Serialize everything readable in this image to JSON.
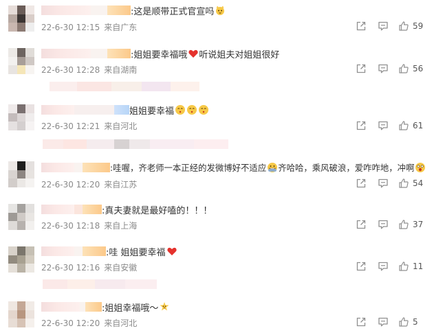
{
  "comments": [
    {
      "text": ":这是顺带正式官宣吗",
      "emoji": "cat-face",
      "date": "22-6-30 12:15",
      "location": "来自广东",
      "likes": "59",
      "reply_blur": false
    },
    {
      "text": ":姐姐要幸福哦",
      "emoji": "red-heart",
      "text2": " 听说姐夫对姐姐很好",
      "date": "22-6-30 12:28",
      "location": "来自湖南",
      "likes": "56",
      "reply_blur": true
    },
    {
      "text": "姐姐要幸福",
      "emoji": "kiss-face-x3",
      "date": "22-6-30 12:21",
      "location": "来自河北",
      "likes": "61",
      "reply_blur": true
    },
    {
      "text": ":哇喔，齐老师一本正经的发微博好不适应",
      "emoji": "grin-face",
      "text2": "齐哈哈，乘风破浪，爱咋咋地，冲啊",
      "date": "22-6-30 12:20",
      "location": "来自江苏",
      "likes": "54",
      "reply_blur": false
    },
    {
      "text": ":真夫妻就是最好嗑的！！！",
      "date": "22-6-30 12:18",
      "location": "来自上海",
      "likes": "37",
      "reply_blur": false
    },
    {
      "text": ":哇 姐姐要幸福",
      "emoji": "red-heart",
      "date": "22-6-30 12:16",
      "location": "来自安徽",
      "likes": "11",
      "reply_blur": true
    },
    {
      "text": ":姐姐幸福哦～",
      "emoji": "sparkle-face",
      "date": "22-6-30 12:20",
      "location": "来自河北",
      "likes": "5",
      "reply_blur": false
    }
  ],
  "colors": {
    "meta_gray": "#8a8a8a",
    "icon_gray": "#8f8f8f",
    "heart_red": "#e5322d"
  },
  "icons": {
    "share": "share-icon",
    "reply": "comment-icon",
    "like": "thumb-up-icon"
  }
}
